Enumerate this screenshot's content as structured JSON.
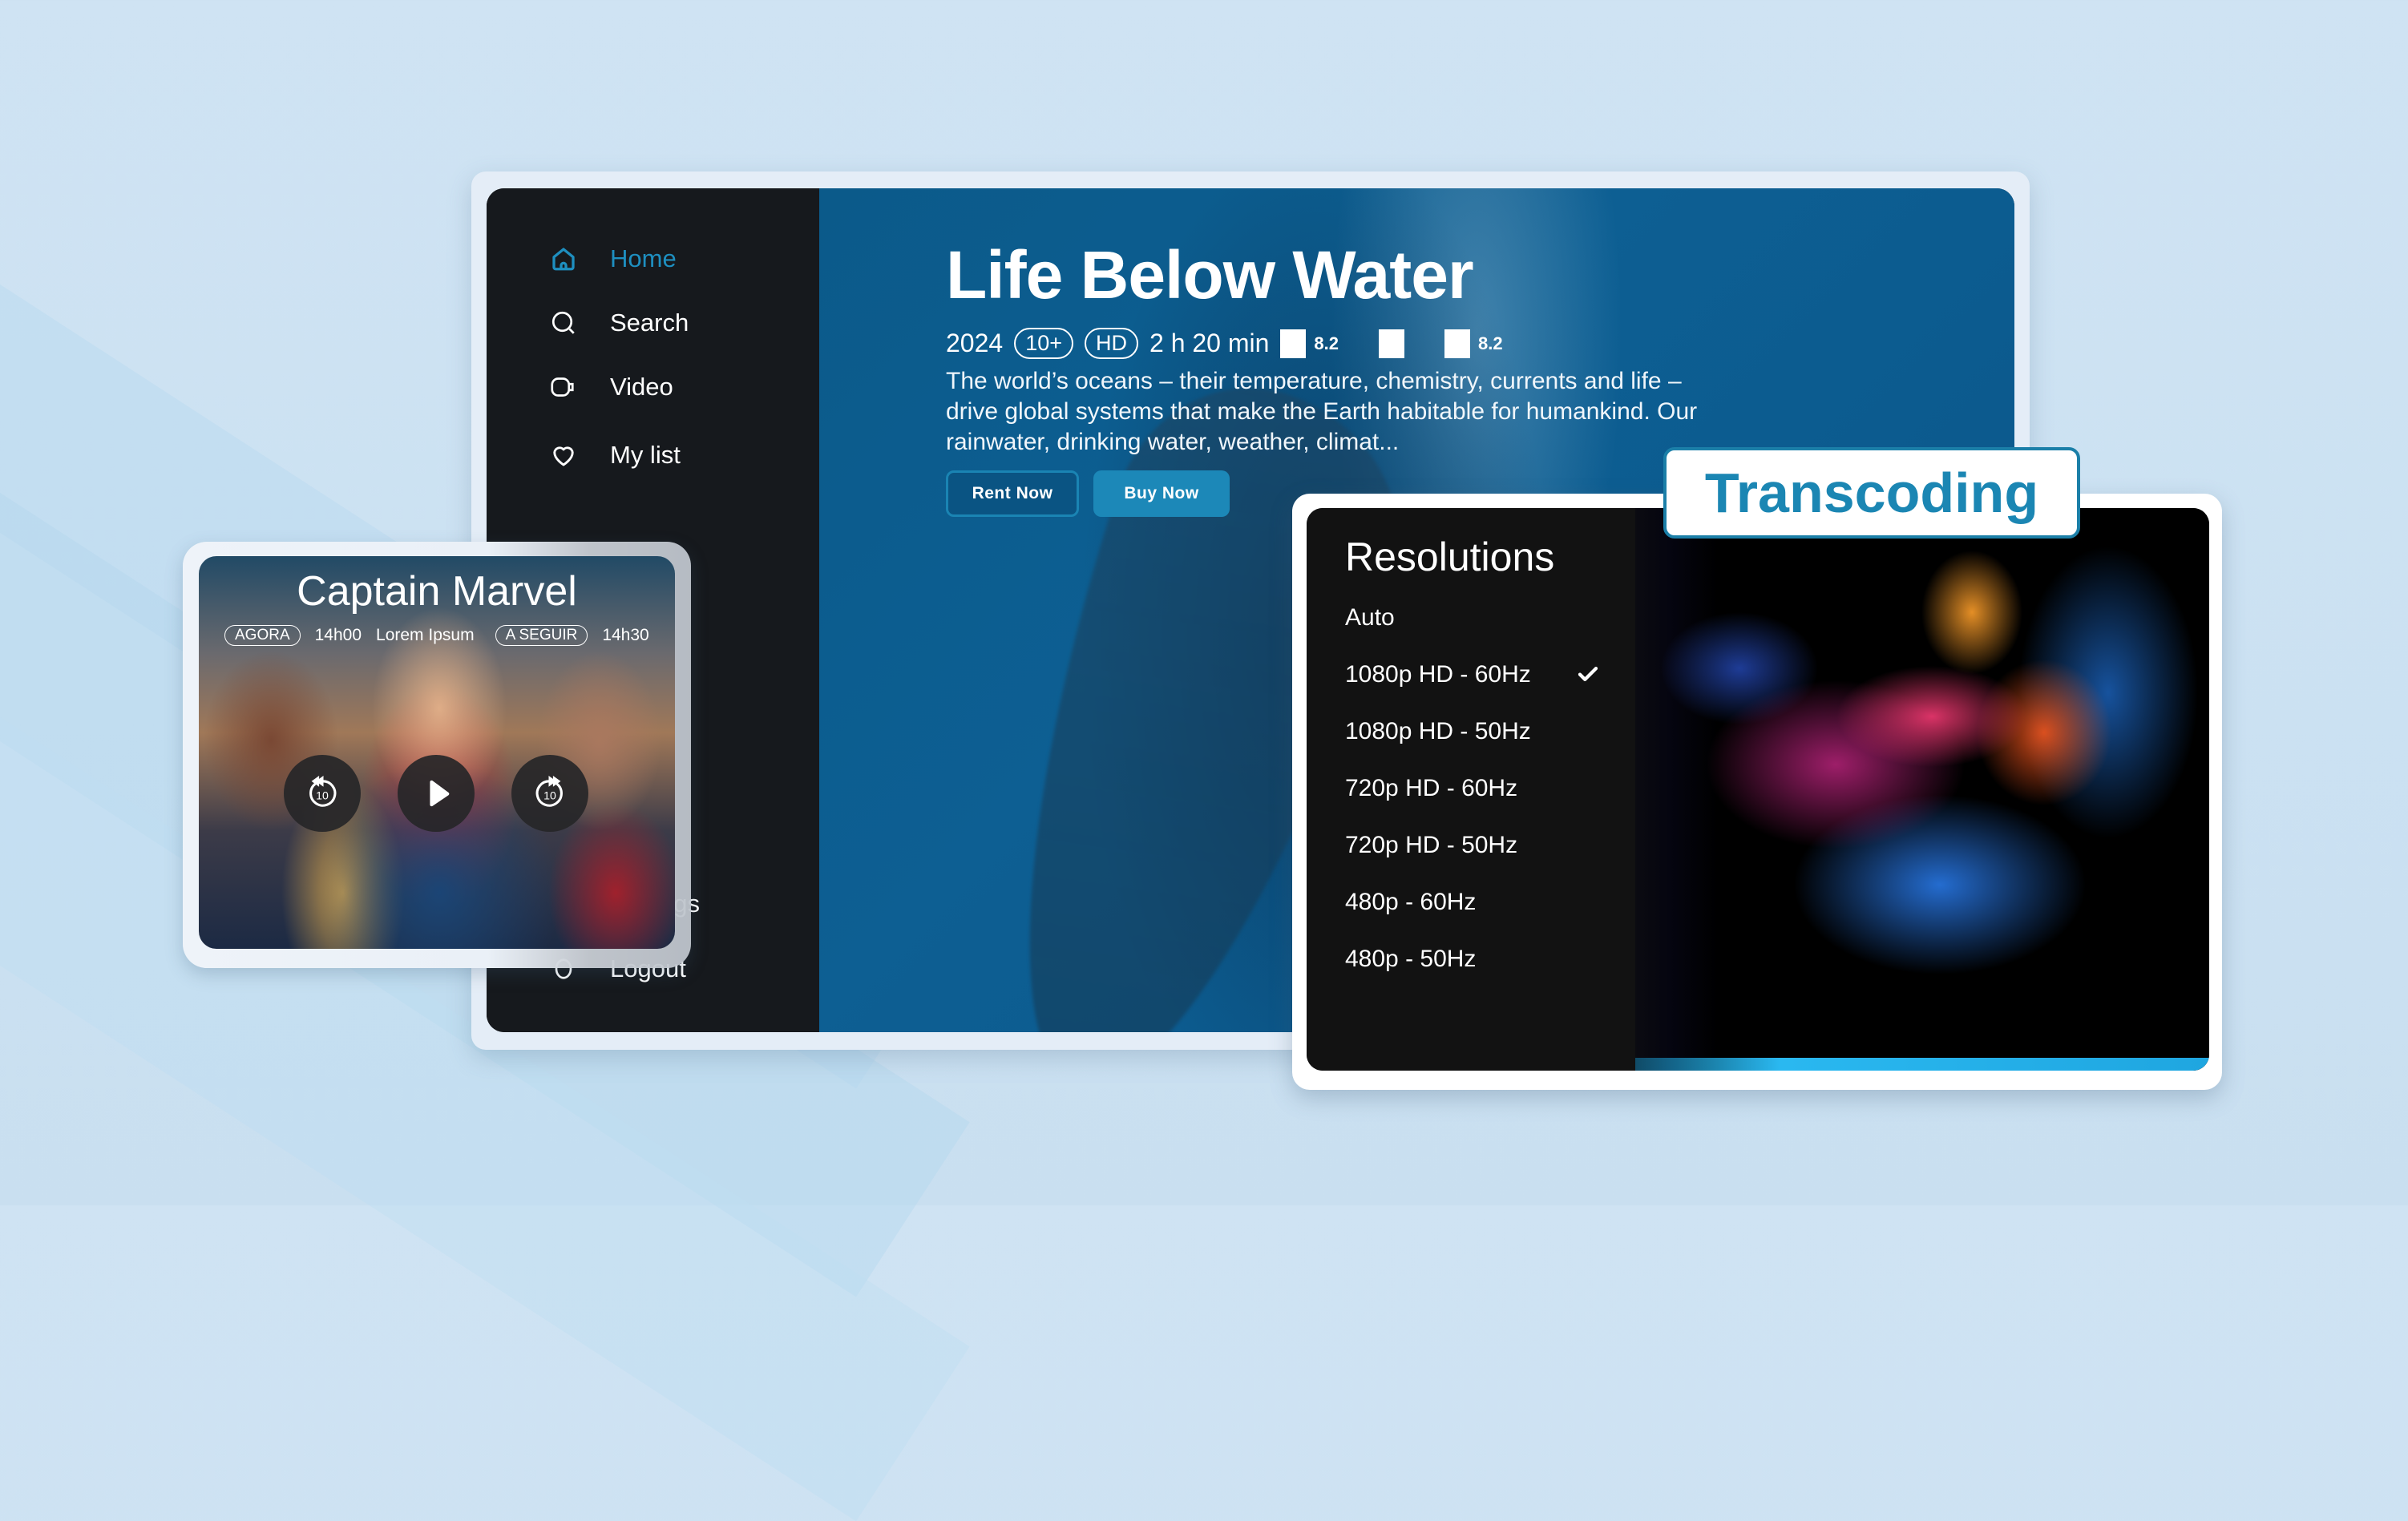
{
  "sidebar": {
    "items": [
      {
        "label": "Home",
        "icon": "home-icon",
        "active": true
      },
      {
        "label": "Search",
        "icon": "search-icon"
      },
      {
        "label": "Video",
        "icon": "video-icon"
      },
      {
        "label": "My list",
        "icon": "heart-icon"
      },
      {
        "label": "Settings",
        "visible_fragment": "s",
        "icon": "settings-icon"
      },
      {
        "label": "Logout",
        "icon": "logout-icon"
      }
    ]
  },
  "hero": {
    "title": "Life Below Water",
    "year": "2024",
    "age_rating": "10+",
    "quality": "HD",
    "duration": "2 h 20 min",
    "ratings": [
      "8.2",
      "",
      "8.2"
    ],
    "description": "The world’s oceans – their temperature, chemistry, currents and life – drive global systems that make the Earth habitable for humankind. Our rainwater, drinking water, weather, climat...",
    "rent_label": "Rent Now",
    "buy_label": "Buy Now"
  },
  "now_playing": {
    "title": "Captain Marvel",
    "now_badge": "AGORA",
    "now_time": "14h00",
    "now_program": "Lorem Ipsum",
    "next_badge": "A SEGUIR",
    "next_time": "14h30",
    "rewind_seconds": "10",
    "forward_seconds": "10"
  },
  "resolutions": {
    "title": "Resolutions",
    "options": [
      "Auto",
      "1080p HD - 60Hz",
      "1080p HD - 50Hz",
      "720p HD - 60Hz",
      "720p HD - 50Hz",
      "480p - 60Hz",
      "480p - 50Hz"
    ],
    "selected": "1080p HD - 60Hz"
  },
  "badge": {
    "label": "Transcoding"
  },
  "colors": {
    "accent": "#1e8fc0",
    "badge_text": "#1b86b3",
    "button_buy": "#1c88b8",
    "sidebar_bg": "#16191d",
    "panel_bg": "#121212",
    "page_bg": "#cfe3f3"
  }
}
